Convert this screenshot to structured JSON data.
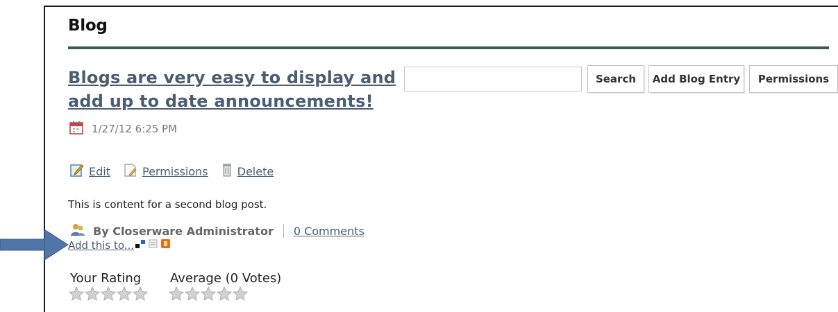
{
  "page": {
    "title": "Blog"
  },
  "post": {
    "title": "Blogs are very easy to display and add up to date announcements!",
    "date": "1/27/12 6:25 PM",
    "content": "This is content for a second blog post.",
    "author": "By Closerware Administrator",
    "comments_label": "0 Comments",
    "add_this_label": "Add this to...",
    "actions": {
      "edit": "Edit",
      "permissions": "Permissions",
      "delete": "Delete"
    }
  },
  "toolbar": {
    "search_value": "",
    "search_button": "Search",
    "add_entry_button": "Add Blog Entry",
    "permissions_button": "Permissions"
  },
  "rating": {
    "your_label": "Your Rating",
    "average_label": "Average (0 Votes)",
    "your_value": 0,
    "average_value": 0,
    "max": 5
  },
  "icons": {
    "calendar": "calendar-icon",
    "edit": "edit-icon",
    "permissions": "permissions-icon",
    "delete": "trash-icon",
    "author": "users-icon",
    "annotation_arrow": "arrow-right-icon"
  },
  "colors": {
    "link": "#4a5d72",
    "rule": "#3d5a49",
    "arrow": "#4f76a6"
  }
}
